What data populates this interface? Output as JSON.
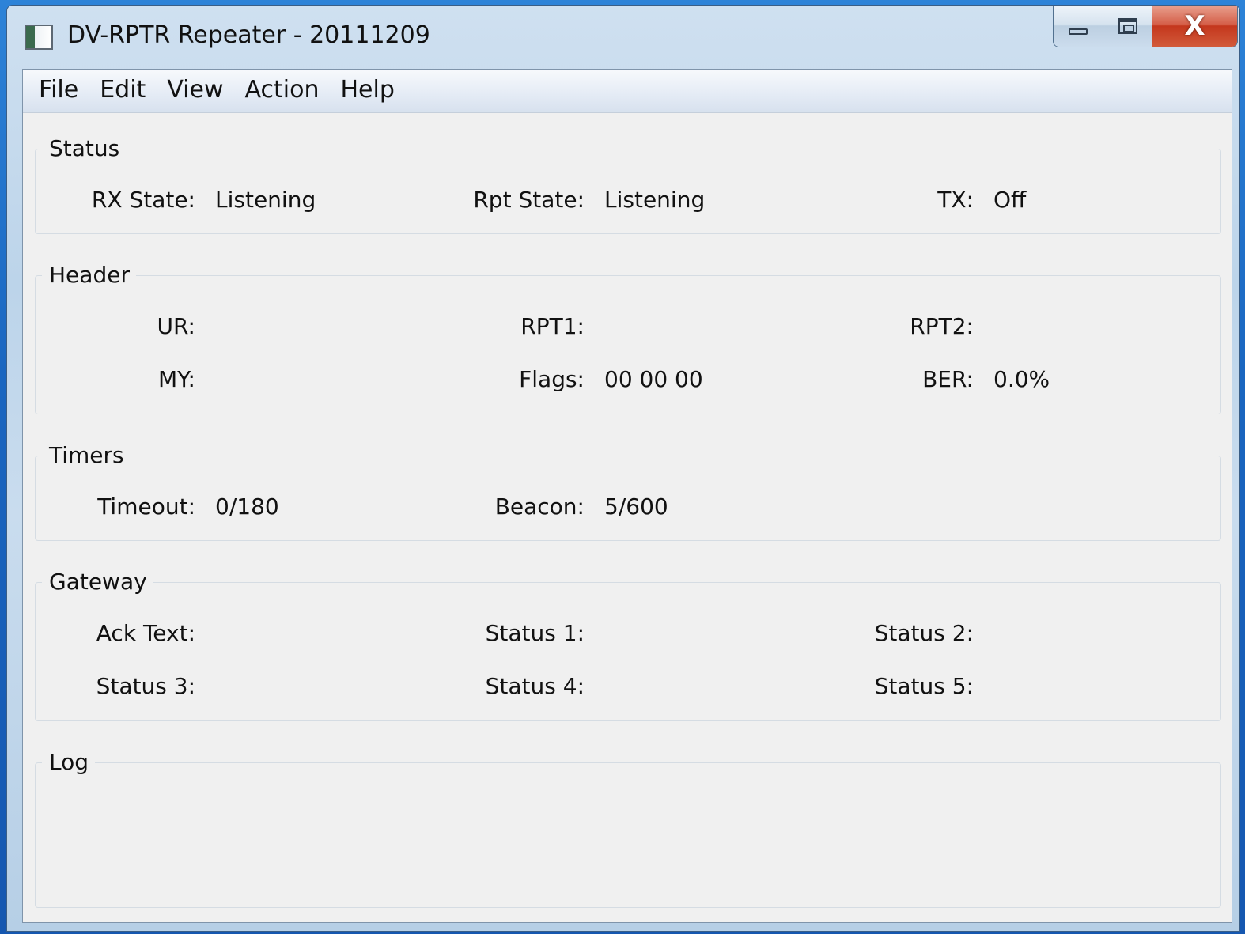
{
  "window": {
    "title": "DV-RPTR Repeater - 20111209",
    "close_glyph": "X"
  },
  "menu": [
    "File",
    "Edit",
    "View",
    "Action",
    "Help"
  ],
  "status": {
    "label": "Status",
    "rx_state_label": "RX State:",
    "rx_state_value": "Listening",
    "rpt_state_label": "Rpt State:",
    "rpt_state_value": "Listening",
    "tx_label": "TX:",
    "tx_value": "Off"
  },
  "header": {
    "label": "Header",
    "ur_label": "UR:",
    "ur_value": "",
    "rpt1_label": "RPT1:",
    "rpt1_value": "",
    "rpt2_label": "RPT2:",
    "rpt2_value": "",
    "my_label": "MY:",
    "my_value": "",
    "flags_label": "Flags:",
    "flags_value": "00 00 00",
    "ber_label": "BER:",
    "ber_value": "0.0%"
  },
  "timers": {
    "label": "Timers",
    "timeout_label": "Timeout:",
    "timeout_value": "0/180",
    "beacon_label": "Beacon:",
    "beacon_value": "5/600"
  },
  "gateway": {
    "label": "Gateway",
    "ack_text_label": "Ack Text:",
    "status1_label": "Status 1:",
    "status2_label": "Status 2:",
    "status3_label": "Status 3:",
    "status4_label": "Status 4:",
    "status5_label": "Status 5:"
  },
  "log": {
    "label": "Log",
    "text": ""
  }
}
